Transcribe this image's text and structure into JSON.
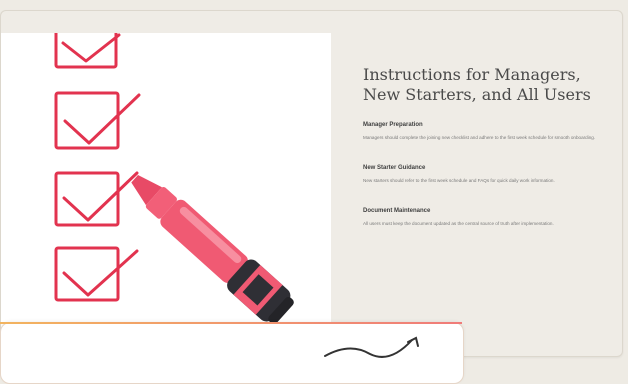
{
  "card": {
    "title_line1": "Instructions for Managers,",
    "title_line2": "New Starters, and All Users"
  },
  "sections": [
    {
      "heading": "Manager Preparation",
      "body": "Managers should complete the joining new checklist and adhere to the first week schedule for smooth onboarding."
    },
    {
      "heading": "New Starter Guidance",
      "body": "New starters should refer to the first week schedule and FAQs for quick daily work information."
    },
    {
      "heading": "Document Maintenance",
      "body": "All users must keep the document updated as the central source of truth after implementation."
    }
  ],
  "colors": {
    "background": "#eeebe4",
    "checkbox_red": "#e2334f",
    "marker_pink": "#f05a73",
    "marker_cap": "#2f2f35"
  },
  "icons": {
    "illustration": "checklist-with-marker",
    "bottom_sketch": "hand-drawn-check"
  }
}
